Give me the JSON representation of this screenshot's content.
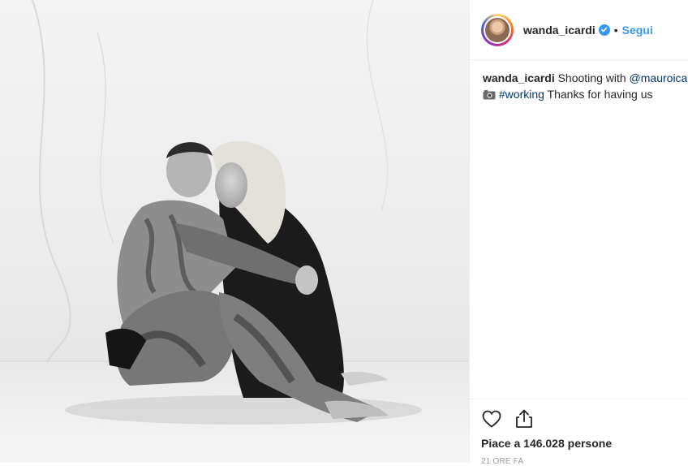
{
  "post": {
    "image_alt": "Black and white photo of a tattooed man and a blonde woman in a black dress seated on a marble floor",
    "photo_icon": "photo-black-and-white"
  },
  "header": {
    "username": "wanda_icardi",
    "verified_icon": "verified-badge-icon",
    "separator": "•",
    "follow_label": "Segui"
  },
  "caption": {
    "username": "wanda_icardi",
    "text_before": " Shooting with ",
    "mention": "@mauroicardi",
    "camera_icon": "camera-emoji",
    "hashtag": "#working",
    "text_after": " Thanks for having us"
  },
  "actions": {
    "like_icon": "heart-icon",
    "share_icon": "share-icon",
    "likes_text": "Piace a 146.028 persone",
    "time_text": "21 ORE FA"
  },
  "colors": {
    "link_blue": "#3897f0",
    "hashtag_blue": "#003569",
    "text": "#262626",
    "muted": "#999999"
  }
}
